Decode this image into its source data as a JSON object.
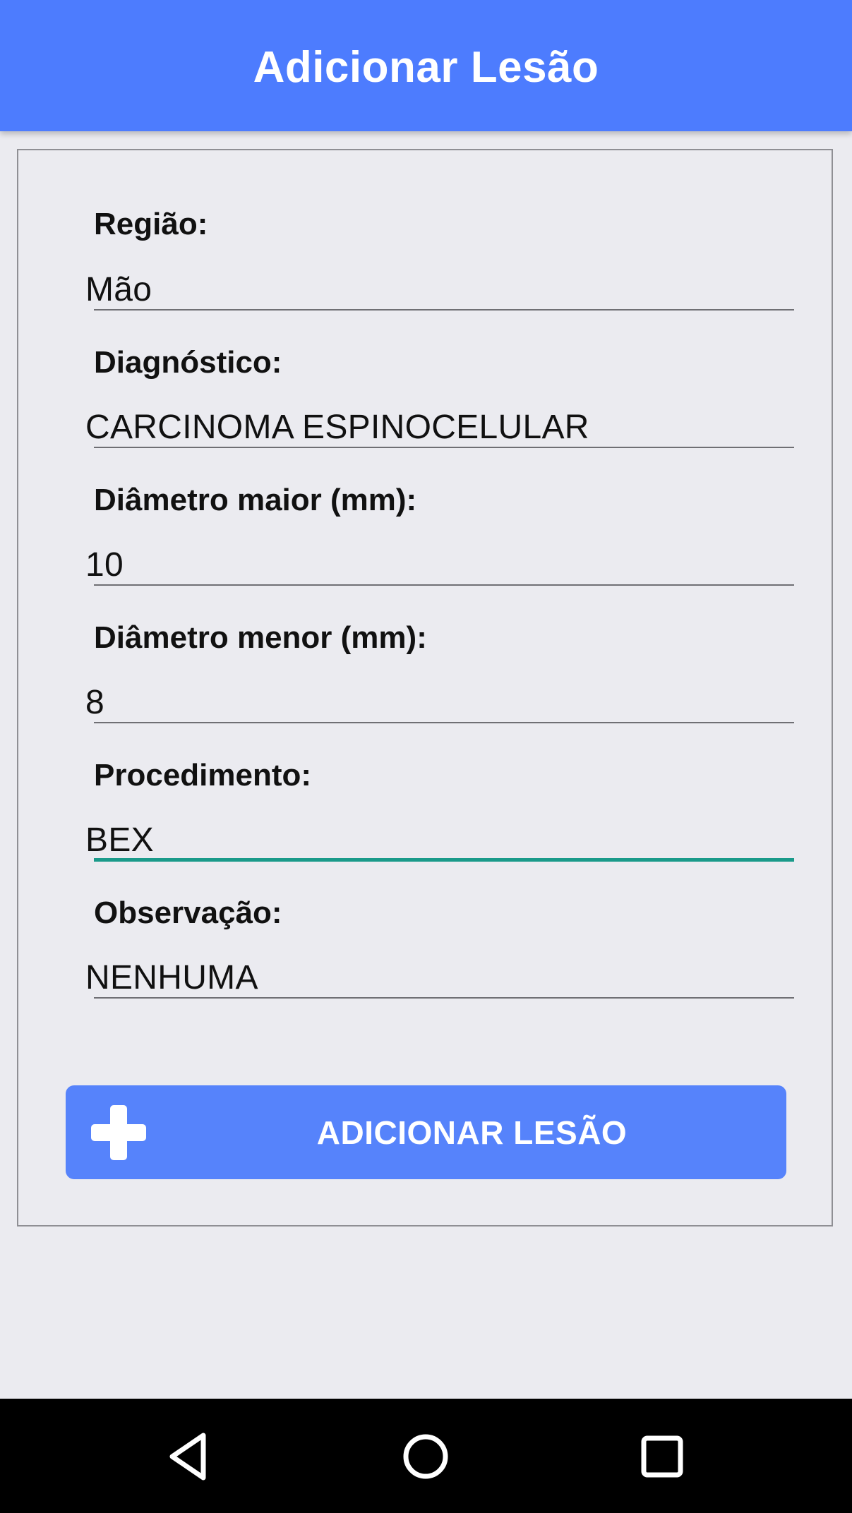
{
  "app_bar": {
    "title": "Adicionar Lesão"
  },
  "form": {
    "fields": [
      {
        "label": "Região:",
        "value": "Mão"
      },
      {
        "label": "Diagnóstico:",
        "value": "CARCINOMA ESPINOCELULAR"
      },
      {
        "label": "Diâmetro maior (mm):",
        "value": "10"
      },
      {
        "label": "Diâmetro menor (mm):",
        "value": "8"
      },
      {
        "label": "Procedimento:",
        "value": "BEX"
      },
      {
        "label": "Observação:",
        "value": "NENHUMA"
      }
    ],
    "focused_field": "Procedimento:"
  },
  "add_button": {
    "label": "ADICIONAR LESÃO",
    "icon": "plus-icon"
  },
  "nav_bar": {
    "icons": [
      "back-icon",
      "home-icon",
      "recent-apps-icon"
    ]
  },
  "colors": {
    "app_bar": "#4d7cfe",
    "button": "#5683fb",
    "focus_underline": "#1a9a8a",
    "background": "#ebebf0"
  }
}
